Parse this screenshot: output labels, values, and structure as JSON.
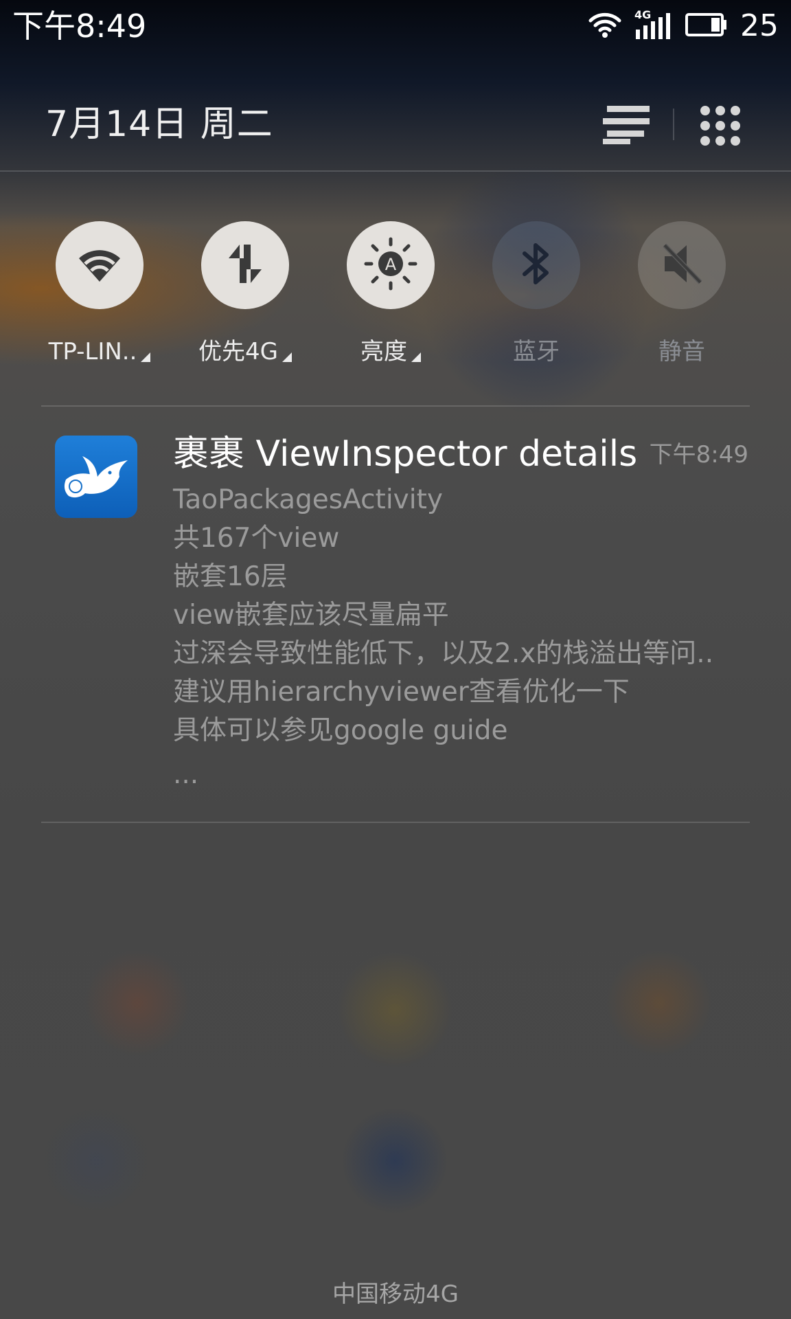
{
  "status_bar": {
    "time": "下午8:49",
    "network_type": "4G",
    "battery_level": "25",
    "icons": [
      "wifi-icon",
      "signal-icon",
      "battery-icon"
    ]
  },
  "header": {
    "date": "7月14日  周二",
    "icons": [
      "notification-list-icon",
      "app-grid-icon"
    ]
  },
  "quick_toggles": [
    {
      "label": "TP-LIN..",
      "icon": "wifi-icon",
      "state": "on",
      "has_menu": true
    },
    {
      "label": "优先4G",
      "icon": "mobile-data-icon",
      "state": "on",
      "has_menu": true
    },
    {
      "label": "亮度",
      "icon": "auto-brightness-icon",
      "state": "on",
      "has_menu": true
    },
    {
      "label": "蓝牙",
      "icon": "bluetooth-icon",
      "state": "off",
      "has_menu": false
    },
    {
      "label": "静音",
      "icon": "mute-icon",
      "state": "off",
      "has_menu": false
    }
  ],
  "notification": {
    "app_icon": "dove-icon",
    "title": "裹裹 ViewInspector details",
    "time": "下午8:49",
    "lines": [
      "TaoPackagesActivity",
      "共167个view",
      "嵌套16层",
      "view嵌套应该尽量扁平",
      "过深会导致性能低下，以及2.x的栈溢出等问..",
      "建议用hierarchyviewer查看优化一下",
      "具体可以参见google guide",
      "..."
    ]
  },
  "carrier": "中国移动4G",
  "colors": {
    "toggle_on": "#e4e1dd",
    "toggle_icon": "#3a3a3a",
    "app_icon_blue": "#1570c9"
  }
}
